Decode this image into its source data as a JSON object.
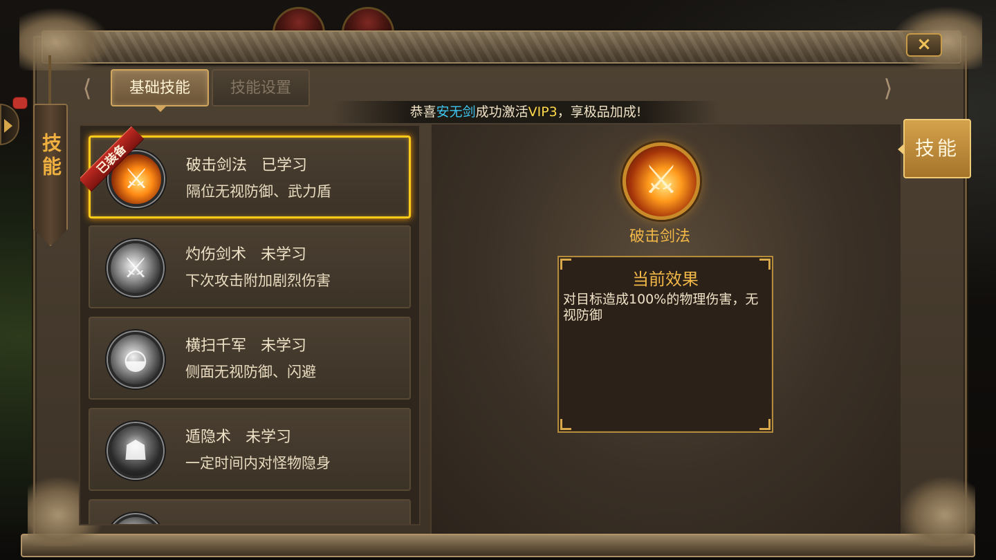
{
  "window": {
    "close_label": "×",
    "side_tag": "技能"
  },
  "tabs": [
    {
      "label": "基础技能",
      "active": true
    },
    {
      "label": "技能设置",
      "active": false
    }
  ],
  "announcement": {
    "prefix": "恭喜",
    "player": "安无剑",
    "middle": "成功激活",
    "vip": "VIP3",
    "suffix": "，享极品加成!"
  },
  "skills": [
    {
      "name": "破击剑法",
      "status": "已学习",
      "desc": "隔位无视防御、武力盾",
      "icon": "fire-sword-icon",
      "equipped": true,
      "badge": "已装备"
    },
    {
      "name": "灼伤剑术",
      "status": "未学习",
      "desc": "下次攻击附加剧烈伤害",
      "icon": "slash-icon",
      "equipped": false
    },
    {
      "name": "横扫千军",
      "status": "未学习",
      "desc": "侧面无视防御、闪避",
      "icon": "sweep-icon",
      "equipped": false
    },
    {
      "name": "遁隐术",
      "status": "未学习",
      "desc": "一定时间内对怪物隐身",
      "icon": "stealth-icon",
      "equipped": false
    }
  ],
  "detail": {
    "name": "破击剑法",
    "effect_title": "当前效果",
    "effect_text": "对目标造成100%的物理伤害，无视防御"
  },
  "right_tag": {
    "label": "技能"
  },
  "colors": {
    "accent_gold": "#f2b848",
    "selected_border": "#ffcc1a",
    "player_name": "#3fc6f0",
    "vip": "#ffd94a"
  }
}
